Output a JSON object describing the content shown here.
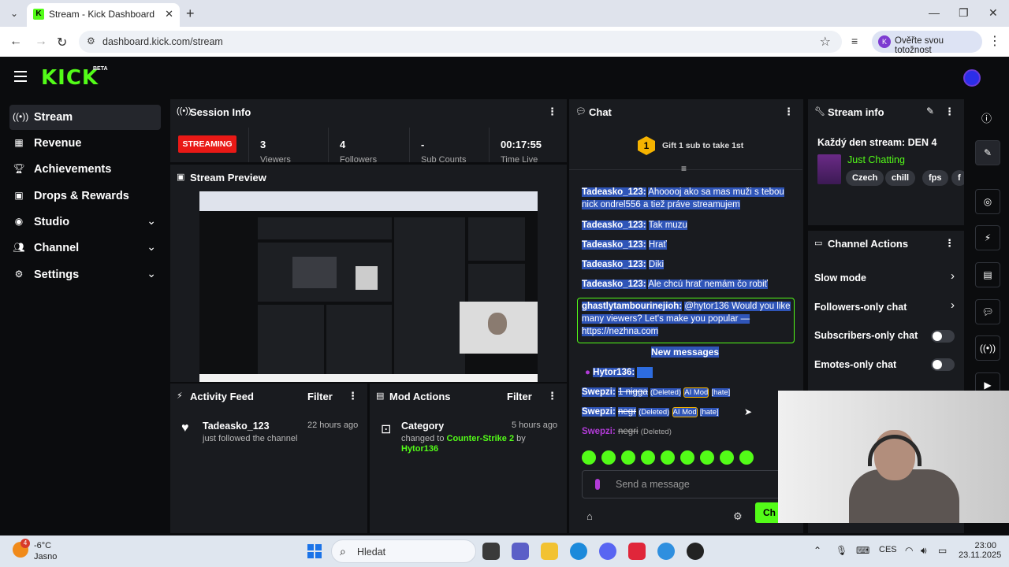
{
  "browser": {
    "tab_title": "Stream - Kick Dashboard",
    "url": "dashboard.kick.com/stream",
    "profile_label": "Ověřte svou totožnost",
    "profile_initial": "K"
  },
  "kick": {
    "logo": "KICK",
    "beta": "BETA"
  },
  "sidebar": {
    "items": [
      {
        "label": "Stream",
        "icon": "broadcast-icon"
      },
      {
        "label": "Revenue",
        "icon": "revenue-icon"
      },
      {
        "label": "Achievements",
        "icon": "trophy-icon"
      },
      {
        "label": "Drops & Rewards",
        "icon": "gift-icon"
      },
      {
        "label": "Studio",
        "icon": "studio-icon"
      },
      {
        "label": "Channel",
        "icon": "people-icon"
      },
      {
        "label": "Settings",
        "icon": "gear-icon"
      }
    ]
  },
  "session": {
    "title": "Session Info",
    "status": "STREAMING",
    "stats": [
      {
        "value": "3",
        "label": "Viewers"
      },
      {
        "value": "4",
        "label": "Followers"
      },
      {
        "value": "-",
        "label": "Sub Counts"
      },
      {
        "value": "00:17:55",
        "label": "Time Live"
      }
    ]
  },
  "preview": {
    "title": "Stream Preview"
  },
  "activity": {
    "title": "Activity Feed",
    "filter": "Filter",
    "items": [
      {
        "name": "Tadeasko_123",
        "sub": "just followed the channel",
        "time": "22 hours ago"
      }
    ]
  },
  "mod": {
    "title": "Mod Actions",
    "filter": "Filter",
    "items": [
      {
        "name": "Category",
        "sub_prefix": "changed to",
        "category": "Counter-Strike 2",
        "by": "by",
        "user": "Hytor136",
        "time": "5 hours ago"
      }
    ]
  },
  "chat": {
    "title": "Chat",
    "gift_text": "Gift 1 sub to take 1st",
    "gift_rank": "1",
    "messages": [
      {
        "user": "Tadeasko_123:",
        "line1": "Ahooooj ako sa mas muži s tebou",
        "line2": "nick ondrel556 a tiež práve streamujem"
      },
      {
        "user": "Tadeasko_123:",
        "line1": "Tak muzu"
      },
      {
        "user": "Tadeasko_123:",
        "line1": "Hrať"
      },
      {
        "user": "Tadeasko_123:",
        "line1": "Diki"
      },
      {
        "user": "Tadeasko_123:",
        "line1": "Ale chcú hrať nemám čo robiť"
      }
    ],
    "system": {
      "user": "ghastlytambourinejioh:",
      "line1": "@hytor136 Would you like",
      "line2": "many viewers? Let's make you popular —",
      "line3": "https://nezhna.com"
    },
    "new_messages": "New messages",
    "hytor": "Hytor136:",
    "deleted": [
      {
        "user": "Swepzi:",
        "text": "1 nigga",
        "tag": "(Deleted)",
        "mod": "AI Mod",
        "reason": "[hate]"
      },
      {
        "user": "Swepzi:",
        "text": "negr",
        "tag": "(Deleted)",
        "mod": "AI Mod",
        "reason": "[hate]"
      },
      {
        "user": "Swepzi:",
        "text": "negri",
        "tag": "(Deleted)"
      }
    ],
    "input_placeholder": "Send a message",
    "send_label": "Ch"
  },
  "stream_info": {
    "title": "Stream info",
    "stream_title": "Každý den stream: DEN 4",
    "category": "Just Chatting",
    "tags": [
      "Czech",
      "chill",
      "fps",
      "f"
    ]
  },
  "channel_actions": {
    "title": "Channel Actions",
    "rows": [
      {
        "label": "Slow mode",
        "type": "chevron"
      },
      {
        "label": "Followers-only chat",
        "type": "chevron"
      },
      {
        "label": "Subscribers-only chat",
        "type": "toggle"
      },
      {
        "label": "Emotes-only chat",
        "type": "toggle"
      }
    ]
  },
  "taskbar": {
    "temp": "-6°C",
    "weather": "Jasno",
    "weather_badge": "4",
    "search": "Hledat",
    "lang": "CES",
    "time": "23:00",
    "date": "23.11.2025"
  },
  "colors": {
    "accent": "#53fc18",
    "live": "#e91916",
    "selection": "#2f55b8"
  }
}
